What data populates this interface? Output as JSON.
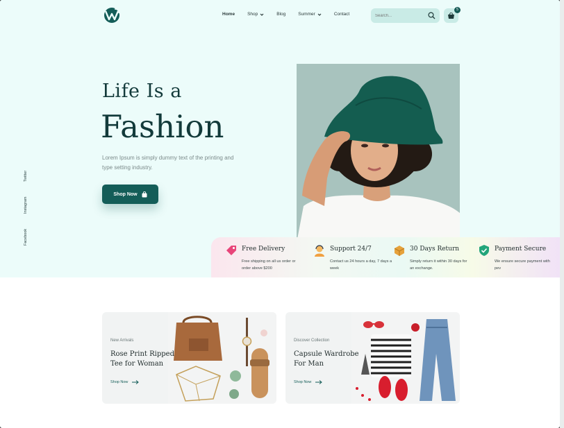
{
  "header": {
    "nav": [
      {
        "label": "Home",
        "active": true,
        "dropdown": false
      },
      {
        "label": "Shop",
        "active": false,
        "dropdown": true
      },
      {
        "label": "Blog",
        "active": false,
        "dropdown": false
      },
      {
        "label": "Summer",
        "active": false,
        "dropdown": true
      },
      {
        "label": "Contact",
        "active": false,
        "dropdown": false
      }
    ],
    "search_placeholder": "Search...",
    "cart_count": "5",
    "icons": {
      "logo": "w-logo-icon",
      "search": "search-icon",
      "cart": "basket-icon",
      "dropdown": "chevron-down-icon"
    }
  },
  "social": [
    "Twitter",
    "Instagram",
    "Facebook"
  ],
  "hero": {
    "line1": "Life Is a",
    "line2": "Fashion",
    "description": "Lorem Ipsum is simply dummy text of the printing and type setting industry.",
    "button_label": "Shop Now",
    "button_icon": "shopping-bag-icon"
  },
  "features": [
    {
      "title": "Free Delivery",
      "desc": "Free shipping on all us order or order above $200",
      "icon": "price-tag-icon"
    },
    {
      "title": "Support 24/7",
      "desc": "Contact us 24 hours a day, 7 days a week",
      "icon": "support-agent-icon"
    },
    {
      "title": "30 Days Return",
      "desc": "Simply return it within 30 days for an exchange.",
      "icon": "return-box-icon"
    },
    {
      "title": "Payment Secure",
      "desc": "We ensure secure payment with pev",
      "icon": "shield-check-icon"
    }
  ],
  "cards": [
    {
      "tag": "New Arrivals",
      "title": "Rose Print Ripped Tee for Woman",
      "link": "Shop Now"
    },
    {
      "tag": "Discover Collection",
      "title": "Capsule Wardrobe For Man",
      "link": "Shop Now"
    }
  ],
  "colors": {
    "brand": "#145d58",
    "hero_bg": "#ecfcfa",
    "title": "#123a3a"
  }
}
